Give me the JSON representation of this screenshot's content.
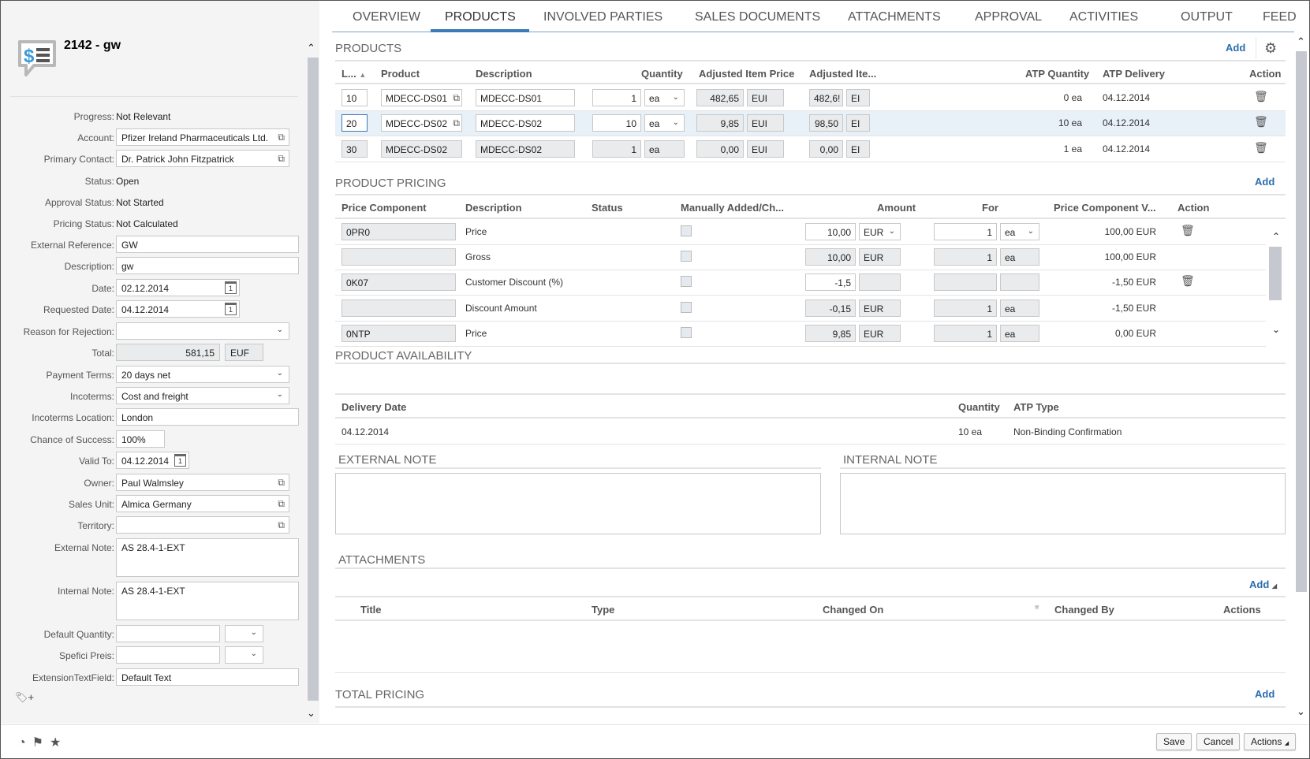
{
  "header": {
    "title": "2142 - gw",
    "icon": "quote-dollar-icon"
  },
  "fields": {
    "progress": {
      "label": "Progress:",
      "value": "Not Relevant"
    },
    "account": {
      "label": "Account:",
      "value": "Pfizer Ireland Pharmaceuticals Ltd."
    },
    "primary_contact": {
      "label": "Primary Contact:",
      "value": "Dr. Patrick John Fitzpatrick"
    },
    "status": {
      "label": "Status:",
      "value": "Open"
    },
    "approval_status": {
      "label": "Approval Status:",
      "value": "Not Started"
    },
    "pricing_status": {
      "label": "Pricing Status:",
      "value": "Not Calculated"
    },
    "external_reference": {
      "label": "External Reference:",
      "value": "GW"
    },
    "description": {
      "label": "Description:",
      "value": "gw"
    },
    "date": {
      "label": "Date:",
      "value": "02.12.2014"
    },
    "requested_date": {
      "label": "Requested Date:",
      "value": "04.12.2014"
    },
    "reason_for_rejection": {
      "label": "Reason for Rejection:",
      "value": ""
    },
    "total": {
      "label": "Total:",
      "value": "581,15",
      "currency": "EUF"
    },
    "payment_terms": {
      "label": "Payment Terms:",
      "value": "20 days net"
    },
    "incoterms": {
      "label": "Incoterms:",
      "value": "Cost and freight"
    },
    "incoterms_location": {
      "label": "Incoterms Location:",
      "value": "London"
    },
    "chance_of_success": {
      "label": "Chance of Success:",
      "value": "100%"
    },
    "valid_to": {
      "label": "Valid To:",
      "value": "04.12.2014"
    },
    "owner": {
      "label": "Owner:",
      "value": "Paul Walmsley"
    },
    "sales_unit": {
      "label": "Sales Unit:",
      "value": "Almica Germany"
    },
    "territory": {
      "label": "Territory:",
      "value": ""
    },
    "external_note": {
      "label": "External Note:",
      "value": "AS 28.4-1-EXT"
    },
    "internal_note": {
      "label": "Internal Note:",
      "value": "AS 28.4-1-EXT"
    },
    "default_quantity": {
      "label": "Default Quantity:",
      "value": "",
      "unit": ""
    },
    "specifi_preis": {
      "label": "Spefici Preis:",
      "value": "",
      "unit": ""
    },
    "extension_text_field": {
      "label": "ExtensionTextField:",
      "value": "Default Text"
    }
  },
  "tabs": [
    {
      "label": "OVERVIEW",
      "active": false
    },
    {
      "label": "PRODUCTS",
      "active": true
    },
    {
      "label": "INVOLVED PARTIES",
      "active": false
    },
    {
      "label": "SALES DOCUMENTS",
      "active": false
    },
    {
      "label": "ATTACHMENTS",
      "active": false
    },
    {
      "label": "APPROVAL",
      "active": false
    },
    {
      "label": "ACTIVITIES",
      "active": false
    },
    {
      "label": "OUTPUT",
      "active": false
    },
    {
      "label": "FEED",
      "active": false
    }
  ],
  "products": {
    "title": "PRODUCTS",
    "add_label": "Add",
    "columns": [
      "L...",
      "Product",
      "Description",
      "Quantity",
      "Adjusted Item Price",
      "Adjusted Ite...",
      "ATP Quantity",
      "ATP Delivery",
      "Action"
    ],
    "rows": [
      {
        "line": "10",
        "product": "MDECC-DS01",
        "description": "MDECC-DS01",
        "quantity": "1",
        "unit": "ea",
        "price": "482,65",
        "price_cur": "EUI",
        "adj": "482,6!",
        "adj_cur": "EI",
        "atp_qty": "0 ea",
        "atp_delivery": "04.12.2014"
      },
      {
        "line": "20",
        "product": "MDECC-DS02",
        "description": "MDECC-DS02",
        "quantity": "10",
        "unit": "ea",
        "price": "9,85",
        "price_cur": "EUI",
        "adj": "98,50",
        "adj_cur": "EI",
        "atp_qty": "10 ea",
        "atp_delivery": "04.12.2014"
      },
      {
        "line": "30",
        "product": "MDECC-DS02",
        "description": "MDECC-DS02",
        "quantity": "1",
        "unit": "ea",
        "price": "0,00",
        "price_cur": "EUI",
        "adj": "0,00",
        "adj_cur": "EI",
        "atp_qty": "1 ea",
        "atp_delivery": "04.12.2014"
      }
    ]
  },
  "pricing": {
    "title": "PRODUCT PRICING",
    "add_label": "Add",
    "columns": [
      "Price Component",
      "Description",
      "Status",
      "Manually Added/Ch...",
      "Amount",
      "For",
      "Price Component V...",
      "Action"
    ],
    "rows": [
      {
        "component": "0PR0",
        "description": "Price",
        "amount": "10,00",
        "currency": "EUR",
        "for": "1",
        "for_unit": "ea",
        "value": "100,00 EUR"
      },
      {
        "component": "",
        "description": "Gross",
        "amount": "10,00",
        "currency": "EUR",
        "for": "1",
        "for_unit": "ea",
        "value": "100,00 EUR"
      },
      {
        "component": "0K07",
        "description": "Customer Discount (%)",
        "amount": "-1,5",
        "currency": "",
        "for": "",
        "for_unit": "",
        "value": "-1,50 EUR"
      },
      {
        "component": "",
        "description": "Discount Amount",
        "amount": "-0,15",
        "currency": "EUR",
        "for": "1",
        "for_unit": "ea",
        "value": "-1,50 EUR"
      },
      {
        "component": "0NTP",
        "description": "Price",
        "amount": "9,85",
        "currency": "EUR",
        "for": "1",
        "for_unit": "ea",
        "value": "0,00 EUR"
      }
    ]
  },
  "availability": {
    "title": "PRODUCT AVAILABILITY",
    "columns": [
      "Delivery Date",
      "Quantity",
      "ATP Type"
    ],
    "rows": [
      {
        "date": "04.12.2014",
        "quantity": "10 ea",
        "type": "Non-Binding Confirmation"
      }
    ]
  },
  "notes": {
    "external_title": "EXTERNAL NOTE",
    "internal_title": "INTERNAL NOTE"
  },
  "attachments": {
    "title": "ATTACHMENTS",
    "add_label": "Add",
    "columns": [
      "Title",
      "Type",
      "Changed On",
      "Changed By",
      "Actions"
    ]
  },
  "total_pricing": {
    "title": "TOTAL PRICING",
    "add_label": "Add"
  },
  "footer": {
    "save": "Save",
    "cancel": "Cancel",
    "actions": "Actions"
  },
  "colors": {
    "accent": "#3c7ab8",
    "link": "#2b6cb0",
    "icon_blue": "#3a9ad9"
  }
}
